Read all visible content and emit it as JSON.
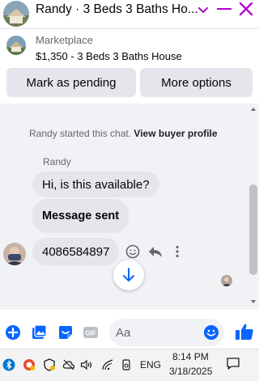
{
  "header": {
    "title": "Randy · 3 Beds 3 Baths Ho...",
    "accent_color": "#b400d0",
    "icons": [
      "avatar",
      "chevron-down-icon",
      "minimize-icon",
      "close-icon"
    ]
  },
  "listing": {
    "source": "Marketplace",
    "title": "$1,350 - 3 Beds 3 Baths House"
  },
  "actions": {
    "pending_label": "Mark as pending",
    "more_label": "More options"
  },
  "chat": {
    "system_prefix": "Randy started this chat.",
    "system_link": "View buyer profile",
    "sender_name": "Randy",
    "messages": [
      {
        "text": "Hi, is this available?"
      },
      {
        "text": "Message sent"
      },
      {
        "text": "4086584897"
      }
    ]
  },
  "composer": {
    "placeholder": "Aa",
    "gif_label": "GIF",
    "brand_color": "#0866ff"
  },
  "taskbar": {
    "language": "ENG",
    "time": "8:14 PM",
    "date": "3/18/2025"
  }
}
